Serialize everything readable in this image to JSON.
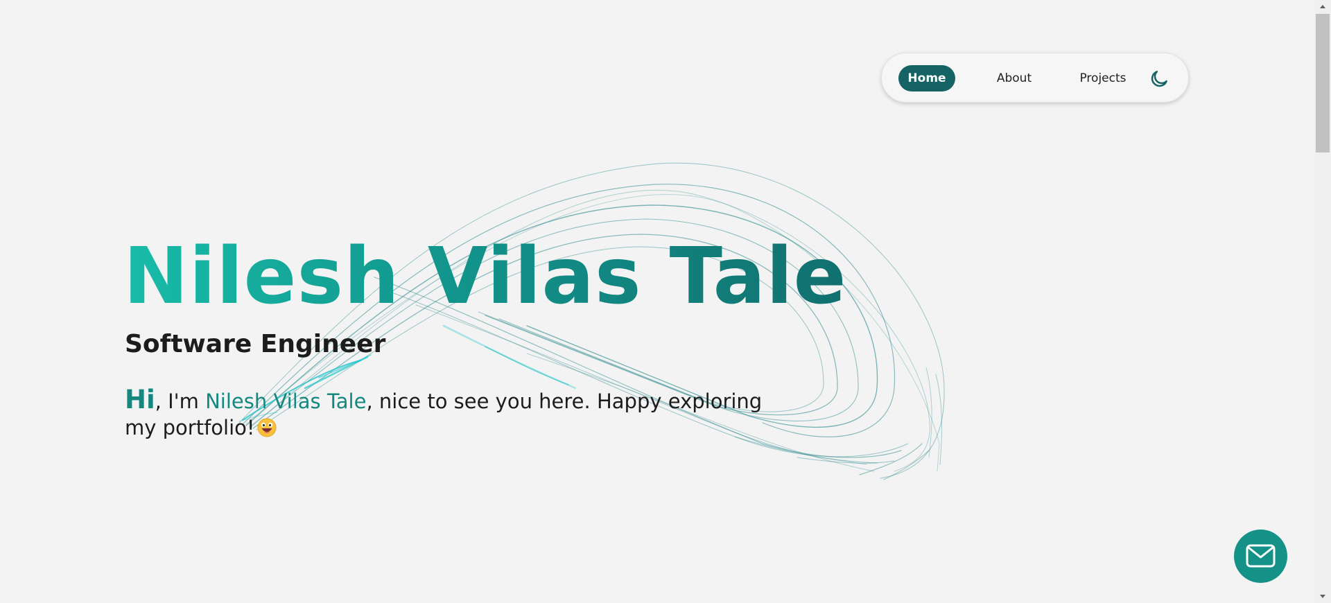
{
  "nav": {
    "items": [
      {
        "label": "Home",
        "active": true
      },
      {
        "label": "About",
        "active": false
      },
      {
        "label": "Projects",
        "active": false
      }
    ],
    "theme_toggle_icon": "moon-icon"
  },
  "hero": {
    "name": "Nilesh Vilas Tale",
    "role": "Software Engineer",
    "intro": {
      "greeting": "Hi",
      "before_name": ", I'm ",
      "name": "Nilesh Vilas Tale",
      "after_name": ", nice to see you here. Happy exploring my portfolio!"
    },
    "emoji_icon": "grinning-face-emoji-icon"
  },
  "fab": {
    "icon": "mail-icon"
  },
  "colors": {
    "background": "#f3f3f3",
    "accent_dark": "#156365",
    "accent": "#14877f",
    "accent_light": "#18bca8",
    "fab": "#149287"
  }
}
